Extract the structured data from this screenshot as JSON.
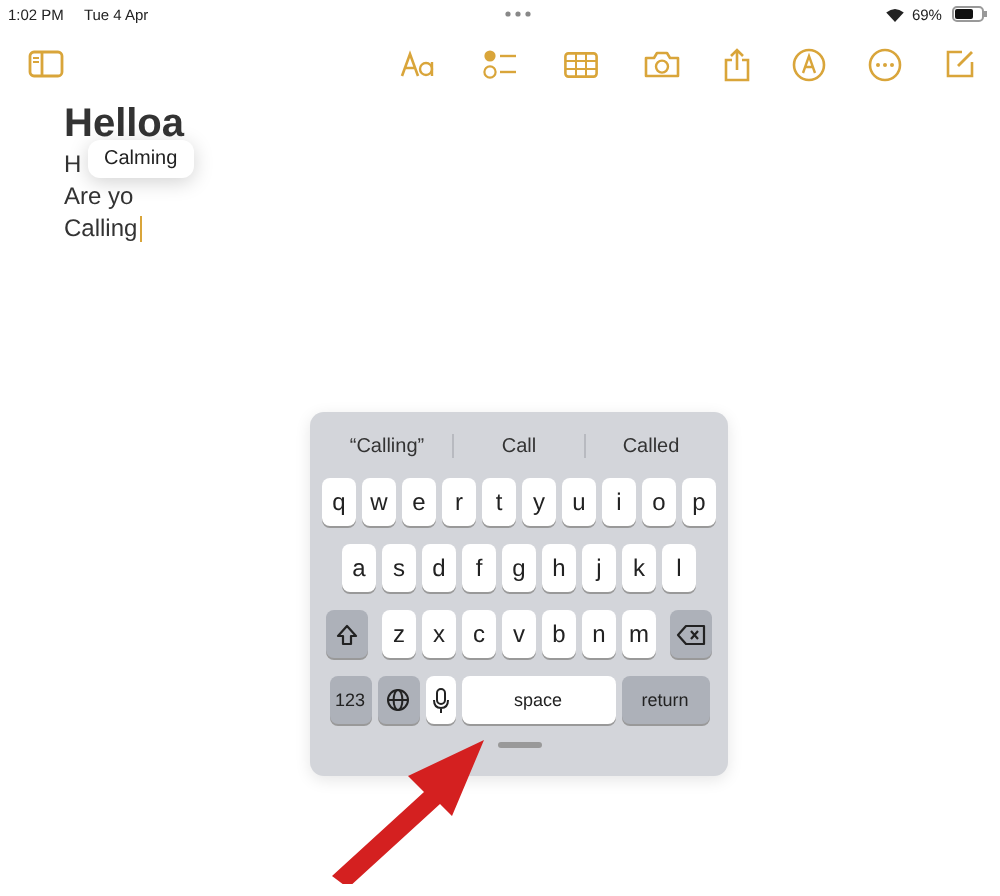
{
  "status_bar": {
    "time": "1:02 PM",
    "date": "Tue 4 Apr",
    "battery": "69%"
  },
  "note": {
    "title": "Helloa",
    "lines": [
      "H",
      "Are yo",
      "Calling"
    ]
  },
  "autocorrect_popup": {
    "text": "Calming"
  },
  "keyboard": {
    "suggestions": [
      "“Calling”",
      "Call",
      "Called"
    ],
    "rows": [
      [
        "q",
        "w",
        "e",
        "r",
        "t",
        "y",
        "u",
        "i",
        "o",
        "p"
      ],
      [
        "a",
        "s",
        "d",
        "f",
        "g",
        "h",
        "j",
        "k",
        "l"
      ],
      [
        "z",
        "x",
        "c",
        "v",
        "b",
        "n",
        "m"
      ]
    ],
    "number_key": "123",
    "space_key": "space",
    "return_key": "return"
  }
}
